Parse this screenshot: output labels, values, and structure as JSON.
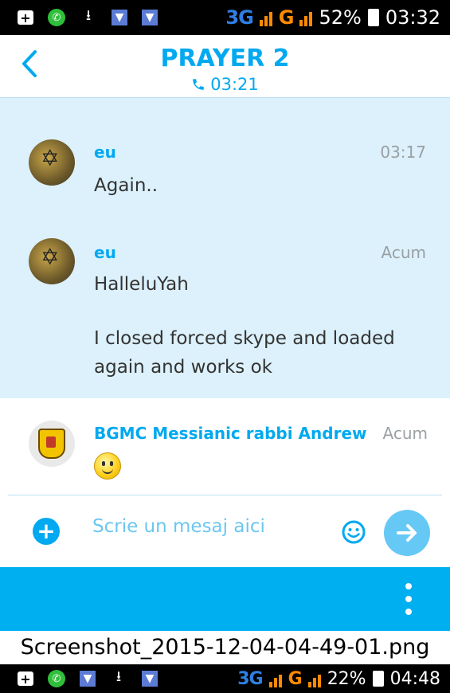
{
  "status_top": {
    "network": "3G",
    "signal_text": "G",
    "battery": "52%",
    "time": "03:32"
  },
  "header": {
    "back_label": "<",
    "title": "PRAYER 2",
    "call_duration": "03:21"
  },
  "messages": [
    {
      "sender": "eu",
      "time": "03:17",
      "lines": [
        "Again.."
      ]
    },
    {
      "sender": "eu",
      "time": "Acum",
      "lines": [
        "HalleluYah",
        "I closed forced skype and loaded again and works ok"
      ]
    },
    {
      "sender": "BGMC Messianic rabbi Andrew",
      "time": "Acum",
      "emoji": "smile"
    }
  ],
  "composer": {
    "placeholder": "Scrie un mesaj aici"
  },
  "caption": "Screenshot_2015-12-04-04-49-01.png",
  "status_bottom": {
    "network": "3G",
    "signal_text": "G",
    "battery": "22%",
    "time": "04:48"
  },
  "icons": {
    "back": "chevron-left-icon",
    "call": "phone-icon",
    "add": "plus-circle-icon",
    "emoji": "smiley-icon",
    "send": "arrow-right-icon",
    "more": "vertical-dots-icon"
  },
  "colors": {
    "accent": "#00aff0",
    "chat_bg": "#dcf1fb"
  }
}
